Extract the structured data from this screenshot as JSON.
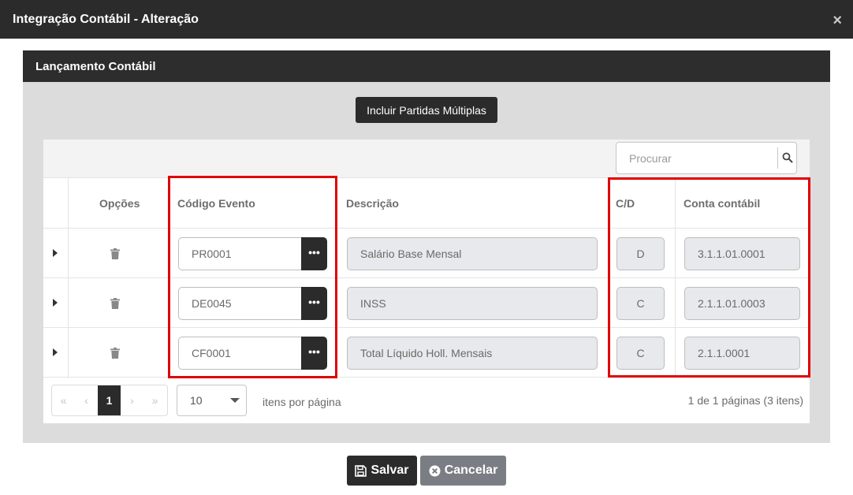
{
  "modal": {
    "title": "Integração Contábil - Alteração",
    "close_glyph": "×"
  },
  "panel": {
    "title": "Lançamento Contábil"
  },
  "actions": {
    "include_multiple": "Incluir Partidas Múltiplas"
  },
  "search": {
    "placeholder": "Procurar"
  },
  "columns": {
    "options": "Opções",
    "event_code": "Código Evento",
    "description": "Descrição",
    "cd": "C/D",
    "account": "Conta contábil"
  },
  "rows": [
    {
      "code": "PR0001",
      "description": "Salário Base Mensal",
      "cd": "D",
      "account": "3.1.1.01.0001"
    },
    {
      "code": "DE0045",
      "description": "INSS",
      "cd": "C",
      "account": "2.1.1.01.0003"
    },
    {
      "code": "CF0001",
      "description": "Total Líquido Holl. Mensais",
      "cd": "C",
      "account": "2.1.1.0001"
    }
  ],
  "lookup_glyph": "•••",
  "pagination": {
    "first": "«",
    "prev": "‹",
    "current": "1",
    "next": "›",
    "last": "»",
    "page_size": "10",
    "per_page_label": "itens por página",
    "info": "1 de 1 páginas (3 itens)"
  },
  "footer": {
    "save": "Salvar",
    "cancel": "Cancelar"
  },
  "colors": {
    "dark": "#2b2b2b",
    "highlight": "#e00000",
    "cancel": "#7a7e84",
    "panel_bg": "#dcdcdc"
  }
}
